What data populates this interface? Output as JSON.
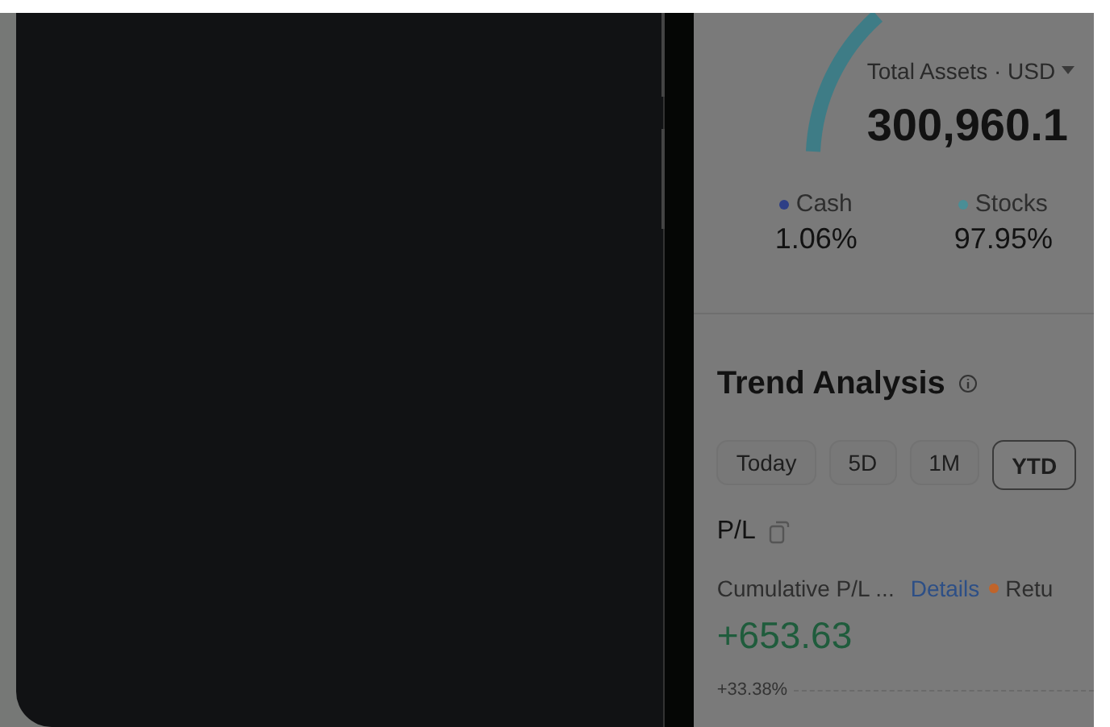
{
  "total": {
    "label": "Total Assets · USD",
    "value": "300,960.1"
  },
  "allocation": [
    {
      "name": "Cash",
      "color": "#2e3f86",
      "value": "1.06%"
    },
    {
      "name": "Stocks",
      "color": "#4a8e96",
      "value": "97.95%"
    }
  ],
  "trend": {
    "title": "Trend Analysis",
    "ranges": [
      {
        "label": "Today",
        "selected": false
      },
      {
        "label": "5D",
        "selected": false
      },
      {
        "label": "1M",
        "selected": false
      },
      {
        "label": "YTD",
        "selected": true
      }
    ],
    "pl_label": "P/L",
    "cumulative_label": "Cumulative P/L ...",
    "details_link": "Details",
    "legend": {
      "label": "Retu",
      "color": "#c0642a"
    },
    "value": "+653.63",
    "axis_label": "+33.38%"
  }
}
